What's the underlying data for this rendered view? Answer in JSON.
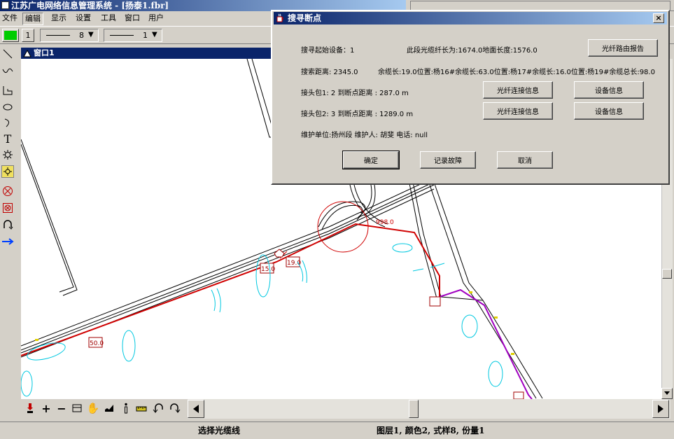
{
  "window": {
    "title": "江苏广电网络信息管理系统 - [扬泰1.fbr]"
  },
  "menu": {
    "items": [
      {
        "label": "文件"
      },
      {
        "label": "编辑"
      },
      {
        "label": "显示"
      },
      {
        "label": "设置"
      },
      {
        "label": "工具"
      },
      {
        "label": "窗口"
      },
      {
        "label": "用户"
      }
    ]
  },
  "toolbar": {
    "color_swatch": "#00cc00",
    "layer_value": "1",
    "line_style_value": "8",
    "line_weight_value": "1"
  },
  "map_window": {
    "title": "窗口1",
    "labels": {
      "value_998": "998.0",
      "value_15": "15.0",
      "value_19": "19.0",
      "value_50": "50.0"
    }
  },
  "dialog": {
    "title": "搜寻断点",
    "close_label": "×",
    "start_device": "搜寻起始设备：1",
    "segment_info": "此段光缆纤长为:1674.0地面长度:1576.0",
    "search_distance": "搜索距离:  2345.0",
    "spare_info": "余缆长:19.0位置:杨16#余缆长:63.0位置:杨17#余缆长:16.0位置:杨19#余缆总长:98.0",
    "splice1": "接头包1:  2  到断点距离  : 287.0 m",
    "splice2": "接头包2: 3  到断点距离  : 1289.0 m",
    "maintenance": "维护单位:扬州段   维护人: 胡斐  电话: null",
    "buttons": {
      "route_report": "光纤路由报告",
      "splice_info_1": "光纤连接信息",
      "device_info_1": "设备信息",
      "splice_info_2": "光纤连接信息",
      "device_info_2": "设备信息",
      "ok": "确定",
      "record_fault": "记录故障",
      "cancel": "取消"
    }
  },
  "status": {
    "left": "选择光缆线",
    "right": "图层1, 颜色2, 式样8, 份量1"
  },
  "colors": {
    "titlebar_dark": "#0a246a",
    "titlebar_light": "#a6caf0",
    "cable_red": "#d00000",
    "cable_purple": "#a000c0",
    "contour_cyan": "#00c8e0",
    "window_bg": "#d4d0c8"
  }
}
